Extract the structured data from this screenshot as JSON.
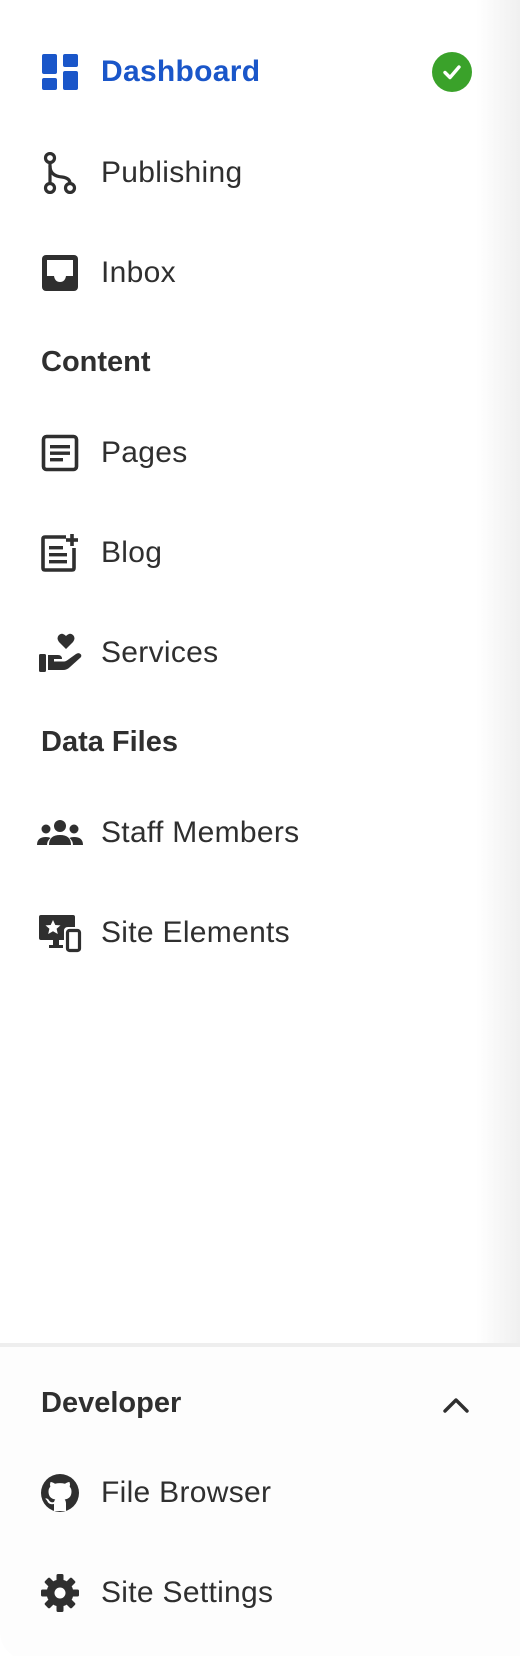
{
  "sidebar": {
    "items": [
      {
        "label": "Dashboard",
        "icon": "dashboard-icon",
        "active": true,
        "status": "check-icon"
      },
      {
        "label": "Publishing",
        "icon": "git-branch-icon"
      },
      {
        "label": "Inbox",
        "icon": "inbox-icon"
      }
    ],
    "sections": [
      {
        "title": "Content",
        "items": [
          {
            "label": "Pages",
            "icon": "page-icon"
          },
          {
            "label": "Blog",
            "icon": "blog-post-icon"
          },
          {
            "label": "Services",
            "icon": "hand-heart-icon"
          }
        ]
      },
      {
        "title": "Data Files",
        "items": [
          {
            "label": "Staff Members",
            "icon": "people-group-icon"
          },
          {
            "label": "Site Elements",
            "icon": "devices-star-icon"
          }
        ]
      }
    ],
    "developer": {
      "title": "Developer",
      "expanded": true,
      "toggle_icon": "chevron-up-icon",
      "items": [
        {
          "label": "File Browser",
          "icon": "github-icon"
        },
        {
          "label": "Site Settings",
          "icon": "gear-icon"
        }
      ]
    }
  },
  "colors": {
    "accent": "#1a56c9",
    "text": "#2f2f2f",
    "status_success": "#3aa22a",
    "background": "#ffffff"
  }
}
